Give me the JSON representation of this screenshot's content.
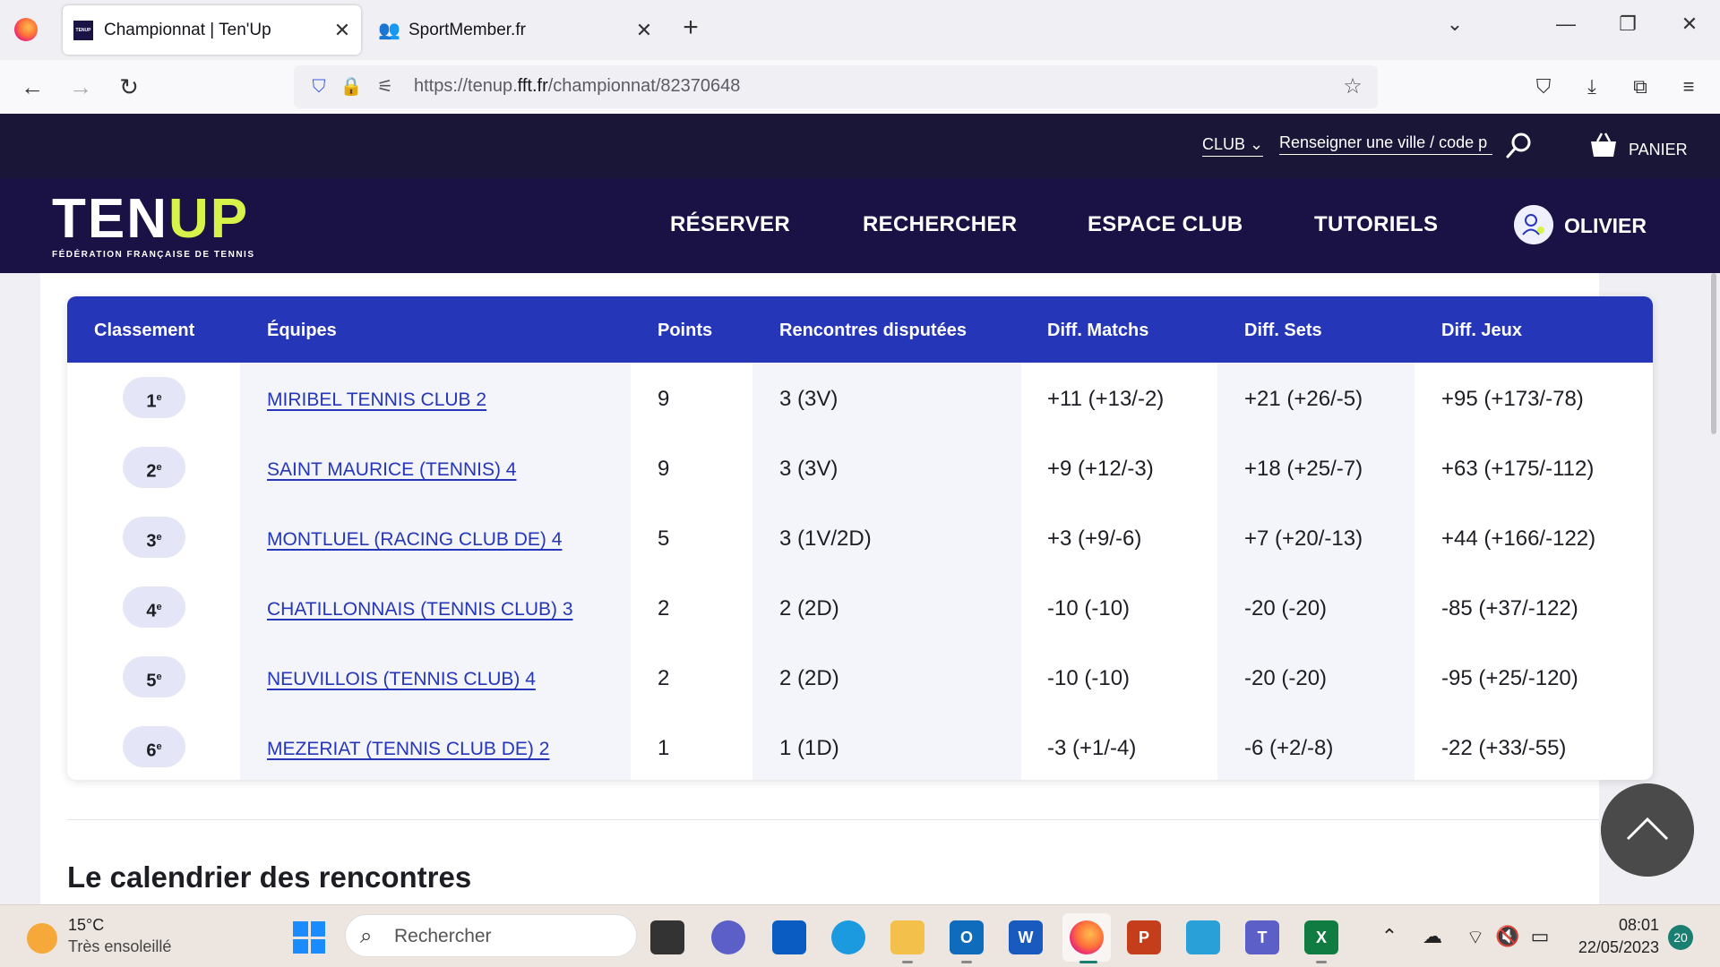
{
  "browser": {
    "tabs": [
      {
        "title": "Championnat | Ten'Up",
        "active": true,
        "favicon": "tenup-favicon-icon"
      },
      {
        "title": "SportMember.fr",
        "active": false,
        "favicon": "sportmember-favicon-icon"
      }
    ],
    "url_prefix": "https://tenup.",
    "url_domain": "fft.fr",
    "url_path": "/championnat/82370648"
  },
  "site": {
    "club_select": "CLUB",
    "city_placeholder": "Renseigner une ville / code p",
    "cart_label": "PANIER",
    "logo_ten": "TEN",
    "logo_up": "UP",
    "logo_sub": "FÉDÉRATION FRANÇAISE DE TENNIS",
    "menu": [
      "RÉSERVER",
      "RECHERCHER",
      "ESPACE CLUB",
      "TUTORIELS"
    ],
    "user": "OLIVIER",
    "colors": {
      "header": "#1a1144",
      "topstrip": "#1a1637",
      "accent": "#d7f34a",
      "table_head": "#2536b8"
    }
  },
  "standings": {
    "headers": [
      "Classement",
      "Équipes",
      "Points",
      "Rencontres disputées",
      "Diff. Matchs",
      "Diff. Sets",
      "Diff. Jeux"
    ],
    "rows": [
      {
        "rank": "1",
        "sup": "e",
        "team": "MIRIBEL TENNIS CLUB 2",
        "points": "9",
        "played": "3 (3V)",
        "matchs": "+11 (+13/-2)",
        "sets": "+21 (+26/-5)",
        "jeux": "+95 (+173/-78)"
      },
      {
        "rank": "2",
        "sup": "e",
        "team": "SAINT MAURICE (TENNIS) 4",
        "points": "9",
        "played": "3 (3V)",
        "matchs": "+9 (+12/-3)",
        "sets": "+18 (+25/-7)",
        "jeux": "+63 (+175/-112)"
      },
      {
        "rank": "3",
        "sup": "e",
        "team": "MONTLUEL (RACING CLUB DE) 4",
        "points": "5",
        "played": "3 (1V/2D)",
        "matchs": "+3 (+9/-6)",
        "sets": "+7 (+20/-13)",
        "jeux": "+44 (+166/-122)"
      },
      {
        "rank": "4",
        "sup": "e",
        "team": "CHATILLONNAIS (TENNIS CLUB) 3",
        "points": "2",
        "played": "2 (2D)",
        "matchs": "-10 (-10)",
        "sets": "-20 (-20)",
        "jeux": "-85 (+37/-122)"
      },
      {
        "rank": "5",
        "sup": "e",
        "team": "NEUVILLOIS (TENNIS CLUB) 4",
        "points": "2",
        "played": "2 (2D)",
        "matchs": "-10 (-10)",
        "sets": "-20 (-20)",
        "jeux": "-95 (+25/-120)"
      },
      {
        "rank": "6",
        "sup": "e",
        "team": "MEZERIAT (TENNIS CLUB DE) 2",
        "points": "1",
        "played": "1 (1D)",
        "matchs": "-3 (+1/-4)",
        "sets": "-6 (+2/-8)",
        "jeux": "-22 (+33/-55)"
      }
    ]
  },
  "section_title": "Le calendrier des rencontres",
  "taskbar": {
    "weather_temp": "15°C",
    "weather_desc": "Très ensoleillé",
    "search_placeholder": "Rechercher",
    "time": "08:01",
    "date": "22/05/2023",
    "notifications": "20"
  }
}
